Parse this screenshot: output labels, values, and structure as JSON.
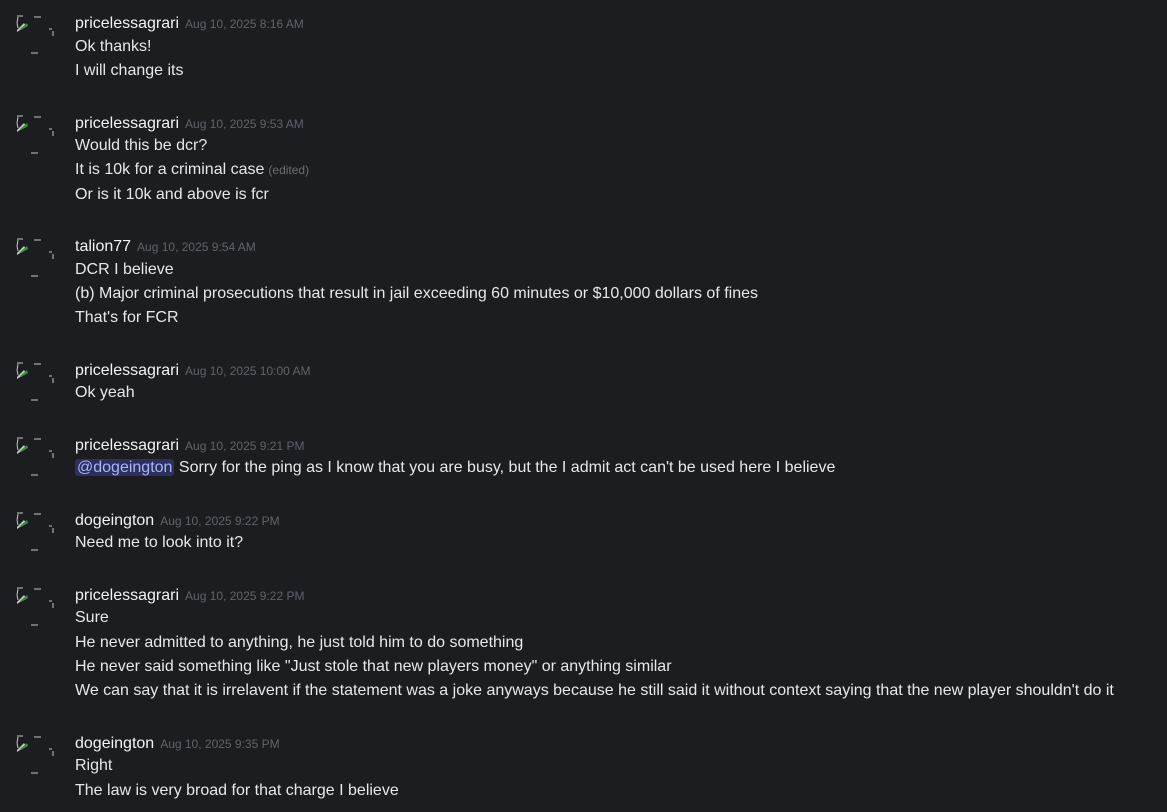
{
  "messages": [
    {
      "author": "pricelessagrari",
      "timestamp": "Aug 10, 2025 8:16 AM",
      "lines": [
        "Ok thanks!",
        "I will change its"
      ]
    },
    {
      "author": "pricelessagrari",
      "timestamp": "Aug 10, 2025 9:53 AM",
      "lines": [
        "Would this be dcr?",
        "It is 10k for a criminal case",
        "Or is it 10k and above is fcr"
      ],
      "edited_label": "(edited)"
    },
    {
      "author": "talion77",
      "timestamp": "Aug 10, 2025 9:54 AM",
      "lines": [
        "DCR I believe",
        "(b) Major criminal prosecutions that result in jail exceeding 60 minutes or $10,000 dollars of fines",
        "That's for FCR"
      ]
    },
    {
      "author": "pricelessagrari",
      "timestamp": "Aug 10, 2025 10:00 AM",
      "lines": [
        "Ok yeah"
      ]
    },
    {
      "author": "pricelessagrari",
      "timestamp": "Aug 10, 2025 9:21 PM",
      "mention": "@dogeington",
      "lines": [
        "Sorry for the ping as I know that you are busy, but the I admit act can't be used here I believe"
      ]
    },
    {
      "author": "dogeington",
      "timestamp": "Aug 10, 2025 9:22 PM",
      "lines": [
        "Need me to look into it?"
      ]
    },
    {
      "author": "pricelessagrari",
      "timestamp": "Aug 10, 2025 9:22 PM",
      "lines": [
        "Sure",
        "He never admitted to anything, he just told him to do something",
        "He never said something like \"Just stole that new players money\" or anything similar",
        "We can say that it is irrelavent if the statement was a joke anyways because he still said it without context saying that the new player shouldn't do it"
      ]
    },
    {
      "author": "dogeington",
      "timestamp": "Aug 10, 2025 9:35 PM",
      "lines": [
        "Right",
        "The law is very broad for that charge I believe"
      ]
    }
  ],
  "colors": {
    "background": "#1c1d21",
    "author": "#f2f3f5",
    "timestamp": "#5f636b",
    "mention_text": "#a9b5ff"
  },
  "icons": {
    "avatar": "broken-image-icon"
  }
}
